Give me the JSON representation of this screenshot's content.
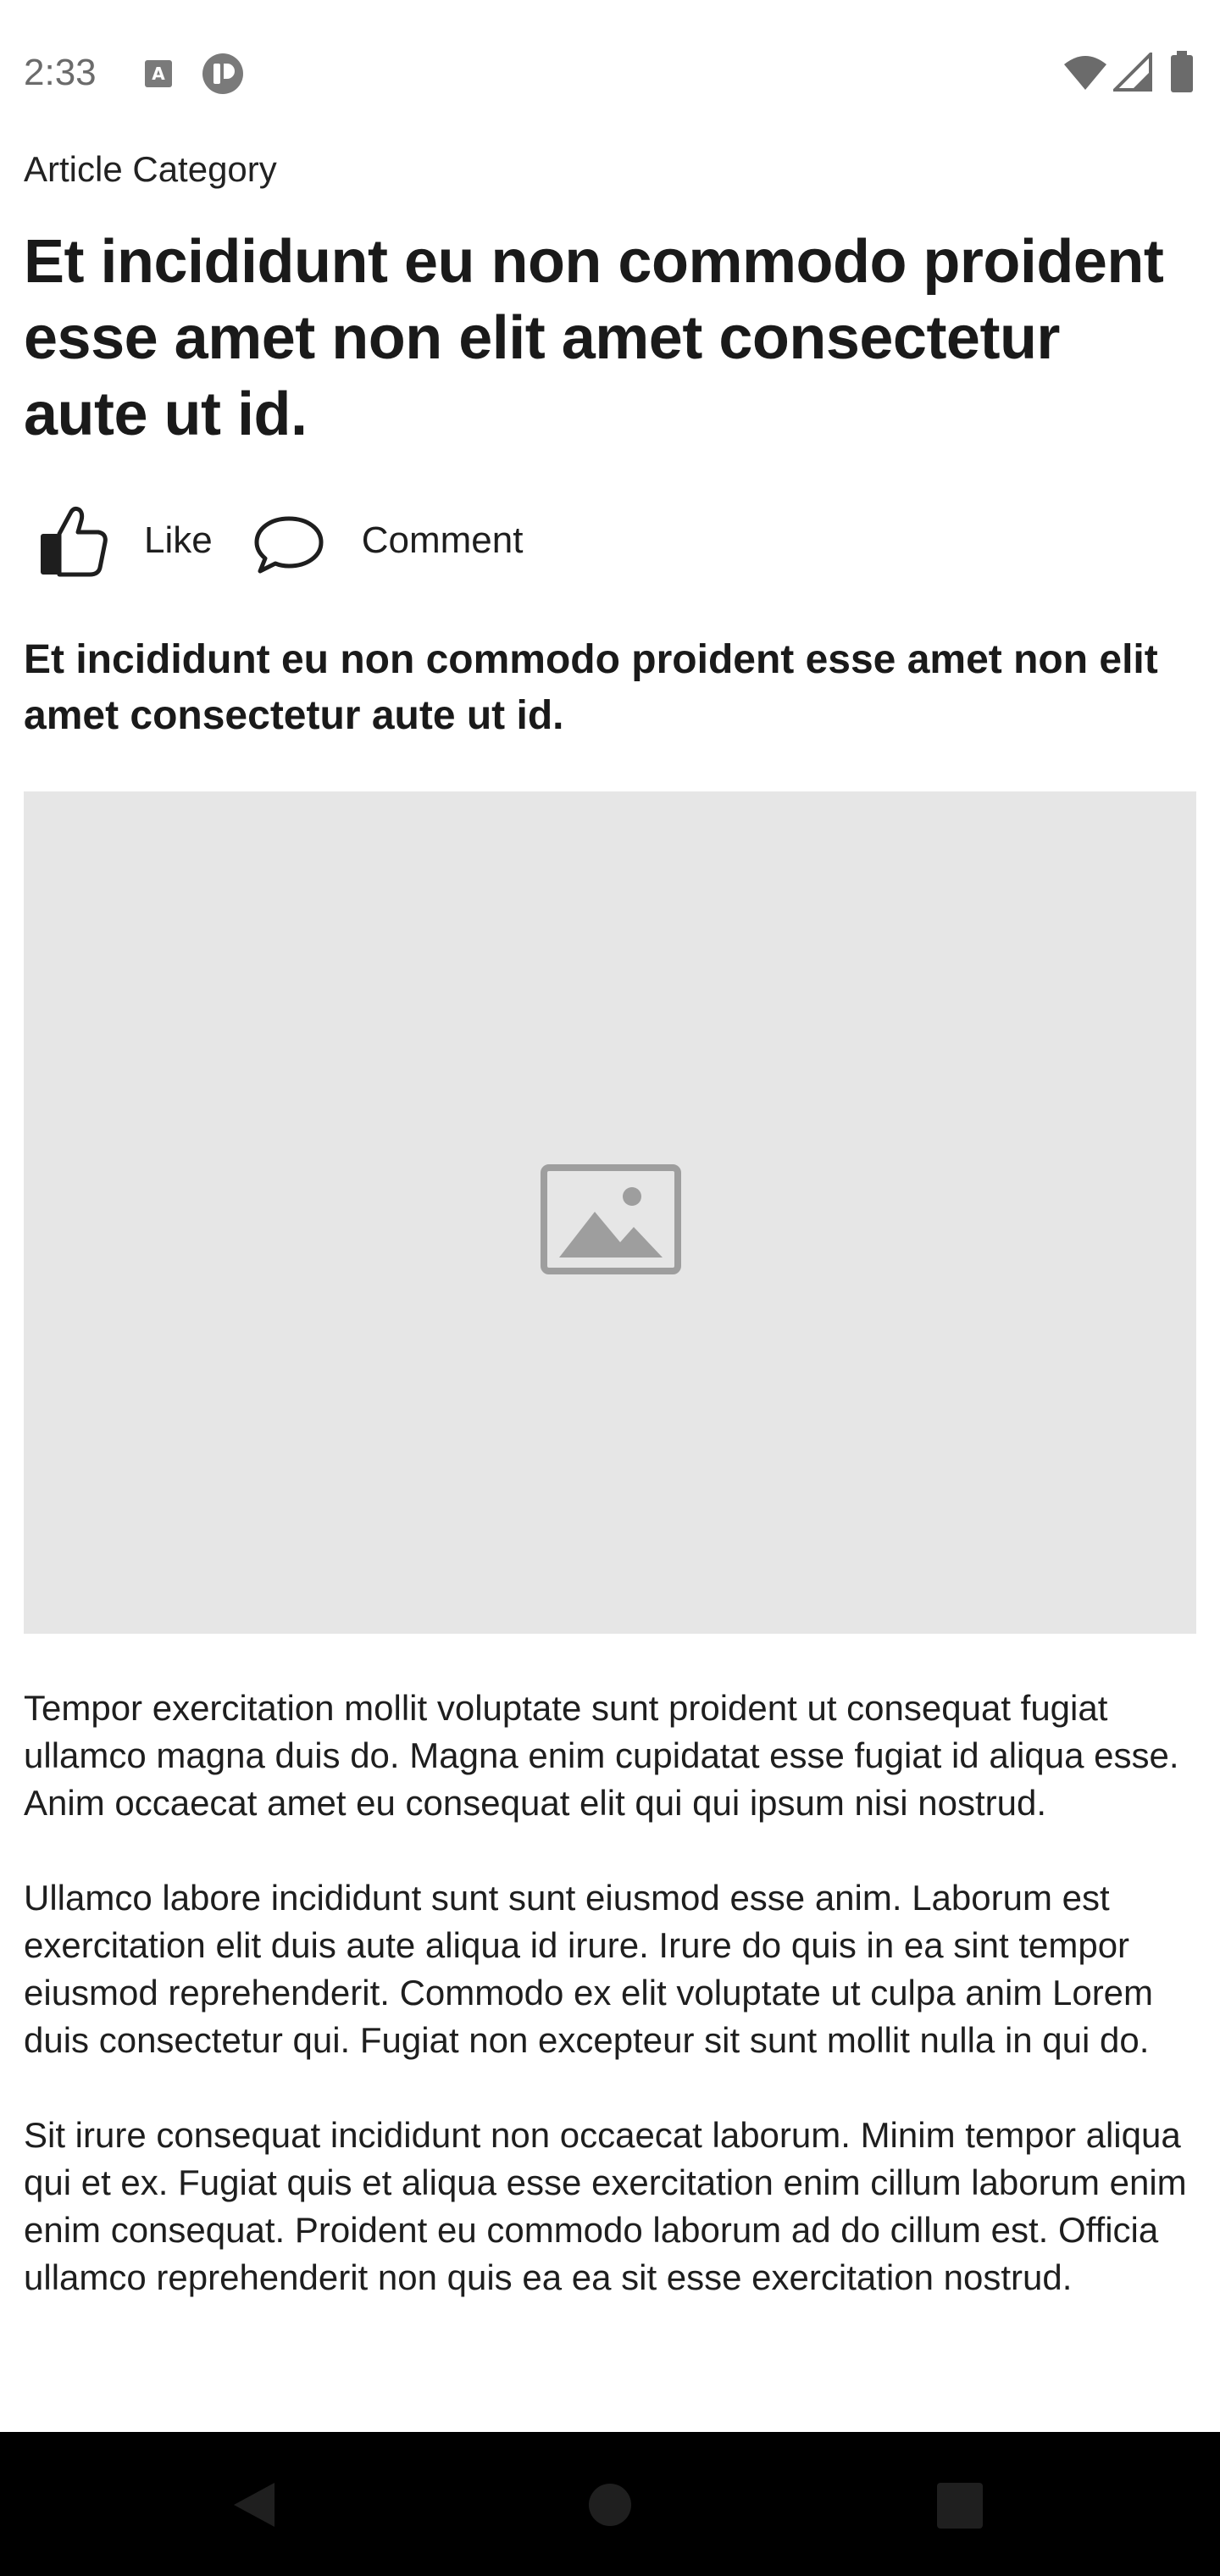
{
  "status_bar": {
    "time": "2:33"
  },
  "article": {
    "category": "Article Category",
    "title": "Et incididunt eu non commodo proident esse amet non elit amet consectetur aute ut id.",
    "subtitle": "Et incididunt eu non commodo proident esse amet non elit amet consectetur aute ut id.",
    "actions": {
      "like_label": "Like",
      "comment_label": "Comment"
    },
    "paragraphs": [
      "Tempor exercitation mollit voluptate sunt proident ut consequat fugiat ullamco magna duis do. Magna enim cupidatat esse fugiat id aliqua esse. Anim occaecat amet eu consequat elit qui qui ipsum nisi nostrud.",
      "Ullamco labore incididunt sunt sunt eiusmod esse anim. Laborum est exercitation elit duis aute aliqua id irure. Irure do quis in ea sint tempor eiusmod reprehenderit. Commodo ex elit voluptate ut culpa anim Lorem duis consectetur qui. Fugiat non excepteur sit sunt mollit nulla in qui do.",
      "Sit irure consequat incididunt non occaecat laborum. Minim tempor aliqua qui et ex. Fugiat quis et aliqua esse exercitation enim cillum laborum enim enim consequat. Proident eu commodo laborum ad do cillum est. Officia ullamco reprehenderit non quis ea ea sit esse exercitation nostrud."
    ]
  },
  "icons": {
    "notification_1": "keyboard-a-icon",
    "notification_2": "app-badge-icon",
    "wifi": "wifi-icon",
    "signal": "cellular-signal-icon",
    "battery": "battery-icon",
    "like": "thumbs-up-icon",
    "comment": "speech-bubble-icon",
    "image_placeholder": "image-placeholder-icon",
    "back": "nav-back-icon",
    "home": "nav-home-icon",
    "recents": "nav-recents-icon"
  },
  "colors": {
    "image_placeholder_bg": "#e6e6e6",
    "image_placeholder_icon": "#9e9e9e",
    "nav_bar_bg": "#000000",
    "nav_icon": "#1f1f1f",
    "status_text": "#6b6b6b"
  }
}
